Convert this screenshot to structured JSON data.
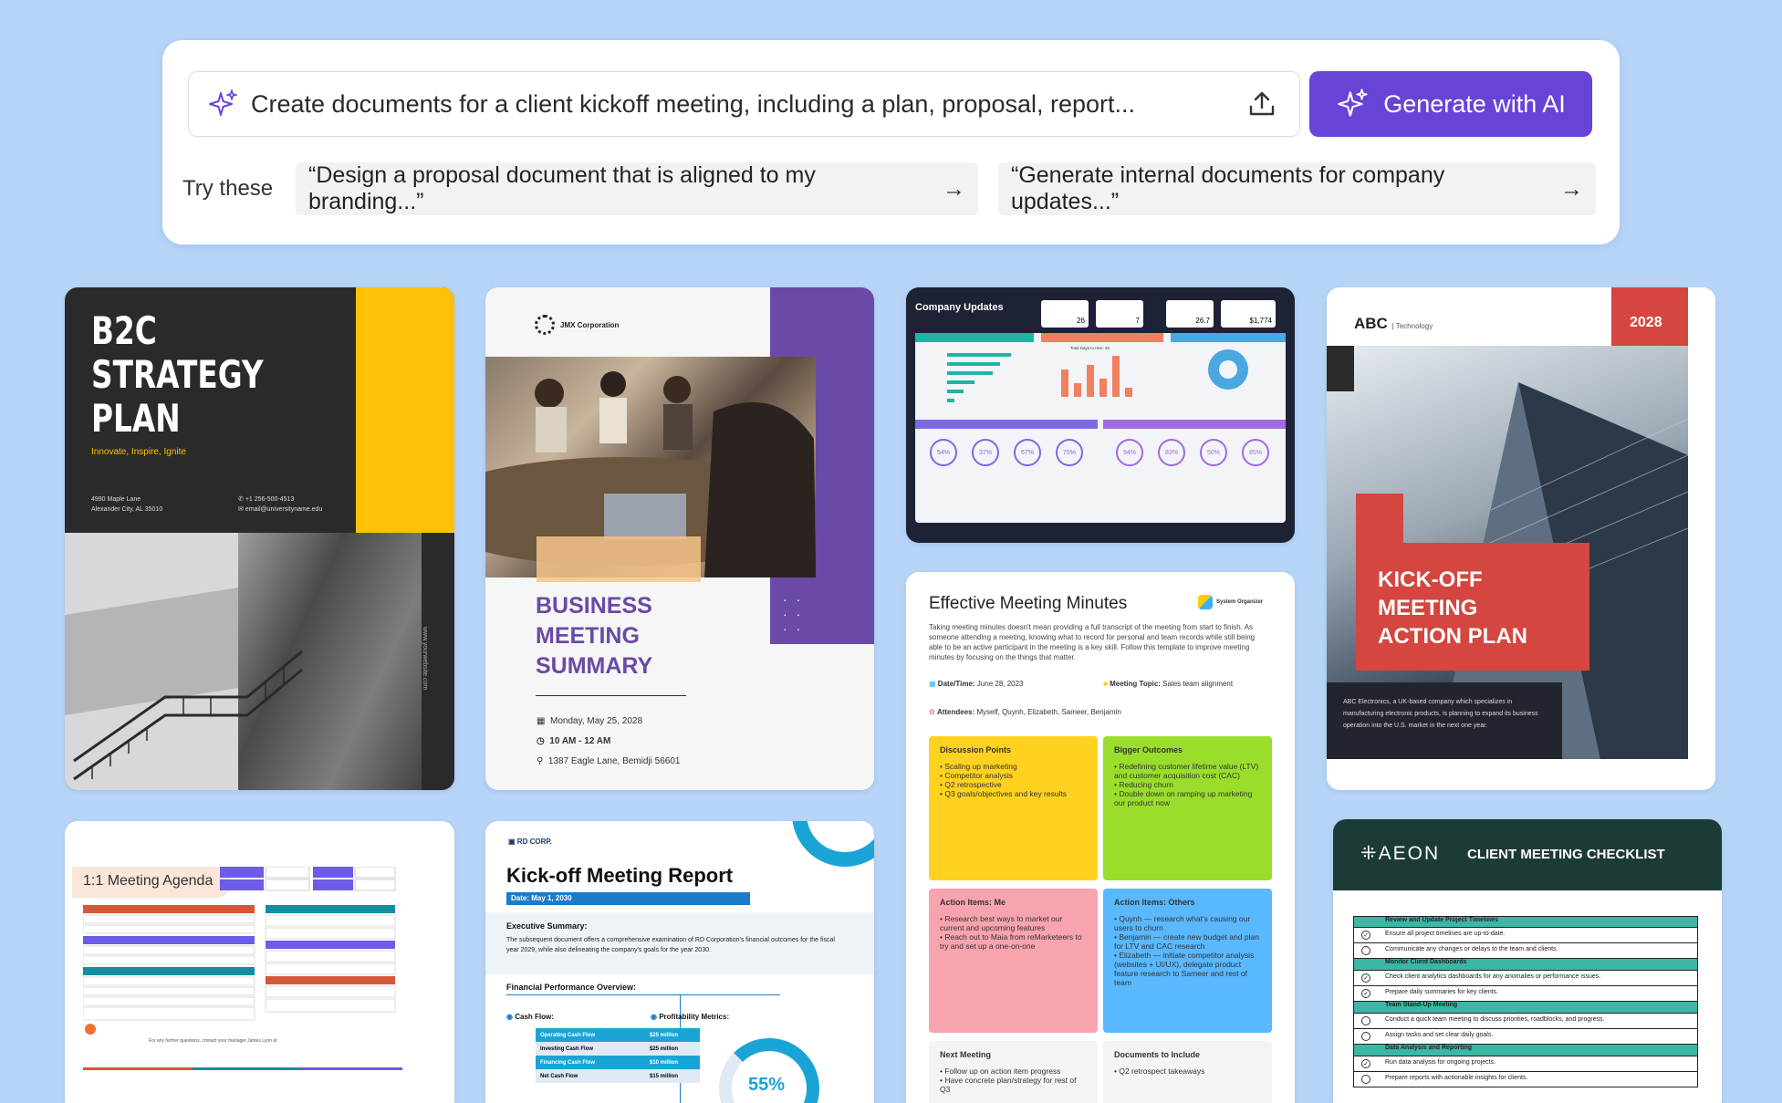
{
  "search": {
    "placeholder": "Create documents for a client kickoff meeting, including a plan, proposal, report...",
    "generate_label": "Generate with AI"
  },
  "suggestions": {
    "label": "Try these",
    "chips": [
      "“Design a proposal document that is aligned to my branding...”",
      "“Generate internal documents for company updates...”"
    ]
  },
  "colors": {
    "background": "#b6d4f8",
    "accent": "#6744d7"
  },
  "templates": {
    "b2c": {
      "title_lines": [
        "B2C",
        "STRATEGY",
        "PLAN"
      ],
      "tagline": "Innovate, Inspire, Ignite",
      "address1": "4990 Maple Lane",
      "address2": "Alexander City, AL 35010",
      "phone": "+1 256-500-4513",
      "email": "email@universityname.edu",
      "website": "www.yourwebsite.com"
    },
    "business": {
      "company": "JMX Corporation",
      "title_lines": [
        "BUSINESS",
        "MEETING",
        "SUMMARY"
      ],
      "date": "Monday, May 25, 2028",
      "time": "10 AM - 12 AM",
      "location": "1387 Eagle Lane, Bemidji 56601"
    },
    "updates": {
      "title": "Company Updates",
      "stats": [
        "26",
        "7",
        "26.7",
        "$1,774"
      ],
      "percents_a": [
        "54%",
        "37%",
        "67%",
        "75%"
      ],
      "percents_b": [
        "94%",
        "83%",
        "50%",
        "85%"
      ],
      "chart_title": "Total Days to Hire: 26"
    },
    "kickoff_plan": {
      "brand": "ABC",
      "brand_sub": "Technology",
      "year": "2028",
      "title_lines": [
        "KICK-OFF",
        "MEETING",
        "ACTION PLAN"
      ],
      "desc": "ABC Electronics, a UK-based company which specializes in manufacturing electronic products, is planning to expand its business operation into the U.S. market in the next one year."
    },
    "agenda": {
      "title": "1:1 Meeting Agenda",
      "footer": "For any further questions, contact your manager James Lynn at"
    },
    "report": {
      "brand": "RD CORP.",
      "title": "Kick-off Meeting Report",
      "date": "Date: May 1, 2030",
      "summary_title": "Executive Summary:",
      "summary": "The subsequent document offers a comprehensive examination of RD Corporation's financial outcomes for the fiscal year 2029, while also delineating the company's goals for the year 2030.",
      "financial_title": "Financial Performance Overview:",
      "cashflow": "Cash Flow:",
      "profitability": "Profitability Metrics:",
      "rows": [
        [
          "Operating Cash Flow",
          "$25 million"
        ],
        [
          "Investing Cash Flow",
          "$25 million"
        ],
        [
          "Financing Cash Flow",
          "$10 million"
        ],
        [
          "Net Cash Flow",
          "$15 million"
        ]
      ],
      "percent": "55%"
    },
    "minutes": {
      "title": "Effective Meeting Minutes",
      "org": "System Organizer",
      "intro": "Taking meeting minutes doesn't mean providing a full transcript of the meeting from start to finish. As someone attending a meeting, knowing what to record for personal and team records while still being able to be an active participant in the meeting is a key skill. Follow this template to improve meeting minutes by focusing on the things that matter.",
      "datetime_label": "Date/Time:",
      "datetime": "June 28, 2023",
      "topic_label": "Meeting Topic:",
      "topic": "Sales team alignment",
      "attendees_label": "Attendees:",
      "attendees": "Myself, Quynh, Elizabeth, Sameer, Benjamin",
      "notes": [
        {
          "title": "Discussion Points",
          "items": [
            "Scaling up marketing",
            "Competitor analysis",
            "Q2 retrospective",
            "Q3 goals/objectives and key results"
          ]
        },
        {
          "title": "Bigger Outcomes",
          "items": [
            "Redefining customer lifetime value (LTV) and customer acquisition cost (CAC)",
            "Reducing churn",
            "Double down on ramping up marketing our product now"
          ]
        },
        {
          "title": "Action Items: Me",
          "items": [
            "Research best ways to market our current and upcoming features",
            "Reach out to Maia from reMarketeers to try and set up a one-on-one"
          ]
        },
        {
          "title": "Action Items: Others",
          "items": [
            "Quynh — research what's causing our users to churn",
            "Benjamin — create new budget and plan for LTV and CAC research",
            "Elizabeth — initiate competitor analysis (websites + UI/UX), delegate product feature research to Sameer and rest of team"
          ]
        },
        {
          "title": "Next Meeting",
          "items": [
            "Follow up on action item progress",
            "Have concrete plan/strategy for rest of Q3"
          ]
        },
        {
          "title": "Documents to Include",
          "items": [
            "Q2 retrospect takeaways"
          ]
        }
      ]
    },
    "checklist": {
      "brand": "AEON",
      "title": "CLIENT MEETING CHECKLIST",
      "sections": [
        {
          "head": "Review and Update Project Timelines",
          "items": [
            "Ensure all project timelines are up-to-date.",
            "Communicate any changes or delays to the team and clients."
          ]
        },
        {
          "head": "Monitor Client Dashboards",
          "items": [
            "Check client analytics dashboards for any anomalies or performance issues.",
            "Prepare daily summaries for key clients."
          ]
        },
        {
          "head": "Team Stand-Up Meeting",
          "items": [
            "Conduct a quick team meeting to discuss priorities, roadblocks, and progress.",
            "Assign tasks and set clear daily goals."
          ]
        },
        {
          "head": "Data Analysis and Reporting",
          "items": [
            "Run data analysis for ongoing projects.",
            "Prepare reports with actionable insights for clients."
          ]
        }
      ]
    }
  }
}
